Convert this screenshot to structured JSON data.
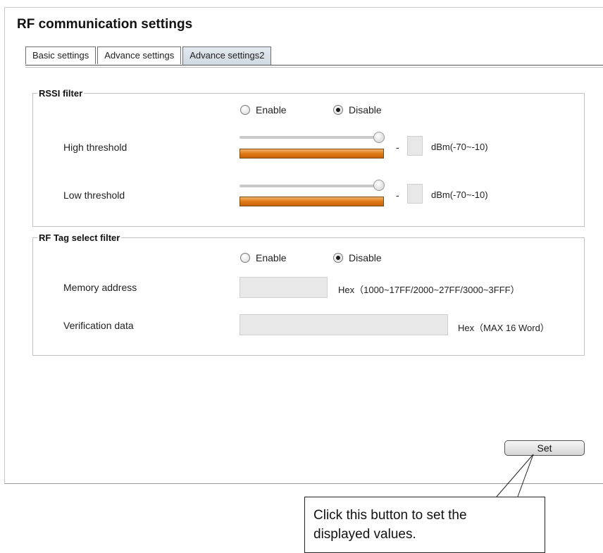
{
  "page": {
    "title": "RF communication settings"
  },
  "tabs": [
    {
      "label": "Basic settings",
      "active": false
    },
    {
      "label": "Advance settings",
      "active": false
    },
    {
      "label": "Advance settings2",
      "active": true
    }
  ],
  "rssi_filter": {
    "legend": "RSSI filter",
    "enable_label": "Enable",
    "disable_label": "Disable",
    "selected": "Disable",
    "high_threshold": {
      "label": "High threshold",
      "separator": "-",
      "value": "",
      "unit": "dBm(-70~-10)",
      "slider_level": 1.0
    },
    "low_threshold": {
      "label": "Low threshold",
      "separator": "-",
      "value": "",
      "unit": "dBm(-70~-10)",
      "slider_level": 1.0
    }
  },
  "tag_filter": {
    "legend": "RF Tag select filter",
    "enable_label": "Enable",
    "disable_label": "Disable",
    "selected": "Disable",
    "memory_address": {
      "label": "Memory address",
      "value": "",
      "note": "Hex（1000~17FF/2000~27FF/3000~3FFF）"
    },
    "verification_data": {
      "label": "Verification data",
      "value": "",
      "note": "Hex（MAX 16 Word）"
    }
  },
  "actions": {
    "set_label": "Set"
  },
  "callout": {
    "line1": "Click this button to set the",
    "line2": "displayed values."
  },
  "colors": {
    "slider_bar": "#e07a16",
    "active_tab": "#d6dee6"
  }
}
